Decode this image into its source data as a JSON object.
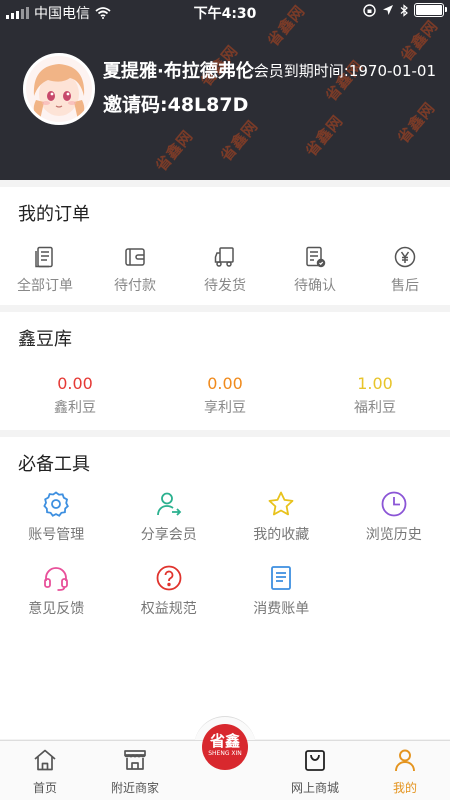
{
  "status_bar": {
    "carrier": "中国电信",
    "time": "下午4:30"
  },
  "profile": {
    "name": "夏提雅·布拉德弗伦",
    "expire_text": "会员到期时间:1970-01-01",
    "invite_text": "邀请码:48L87D",
    "watermark": "省鑫网"
  },
  "orders": {
    "title": "我的订单",
    "items": [
      {
        "label": "全部订单",
        "icon": "document-list-icon"
      },
      {
        "label": "待付款",
        "icon": "wallet-icon"
      },
      {
        "label": "待发货",
        "icon": "truck-icon"
      },
      {
        "label": "待确认",
        "icon": "checked-document-icon"
      },
      {
        "label": "售后",
        "icon": "yen-coin-icon"
      }
    ]
  },
  "beans": {
    "title": "鑫豆库",
    "items": [
      {
        "value": "0.00",
        "label": "鑫利豆",
        "color": "#e53935"
      },
      {
        "value": "0.00",
        "label": "享利豆",
        "color": "#f08a1c"
      },
      {
        "value": "1.00",
        "label": "福利豆",
        "color": "#e8c42a"
      }
    ]
  },
  "tools": {
    "title": "必备工具",
    "items": [
      {
        "label": "账号管理",
        "icon": "gear-icon",
        "color": "#3d8fe0"
      },
      {
        "label": "分享会员",
        "icon": "person-share-icon",
        "color": "#2bb18f"
      },
      {
        "label": "我的收藏",
        "icon": "star-icon",
        "color": "#e8c21c"
      },
      {
        "label": "浏览历史",
        "icon": "clock-icon",
        "color": "#8b55d6"
      },
      {
        "label": "意见反馈",
        "icon": "headset-icon",
        "color": "#e8509a"
      },
      {
        "label": "权益规范",
        "icon": "question-circle-icon",
        "color": "#e0332d"
      },
      {
        "label": "消费账单",
        "icon": "bill-icon",
        "color": "#3d8fe0"
      }
    ]
  },
  "tabbar": {
    "items": [
      {
        "label": "首页",
        "icon": "home-icon"
      },
      {
        "label": "附近商家",
        "icon": "store-icon"
      },
      {
        "label": "网上商城",
        "icon": "shopping-bag-icon"
      },
      {
        "label": "我的",
        "icon": "person-icon",
        "active": true
      }
    ],
    "center_logo_text": "省鑫",
    "center_logo_sub": "SHENG XIN"
  },
  "colors": {
    "header_bg": "#2c2d34",
    "accent": "#e4941f",
    "logo_red": "#d8282e"
  }
}
